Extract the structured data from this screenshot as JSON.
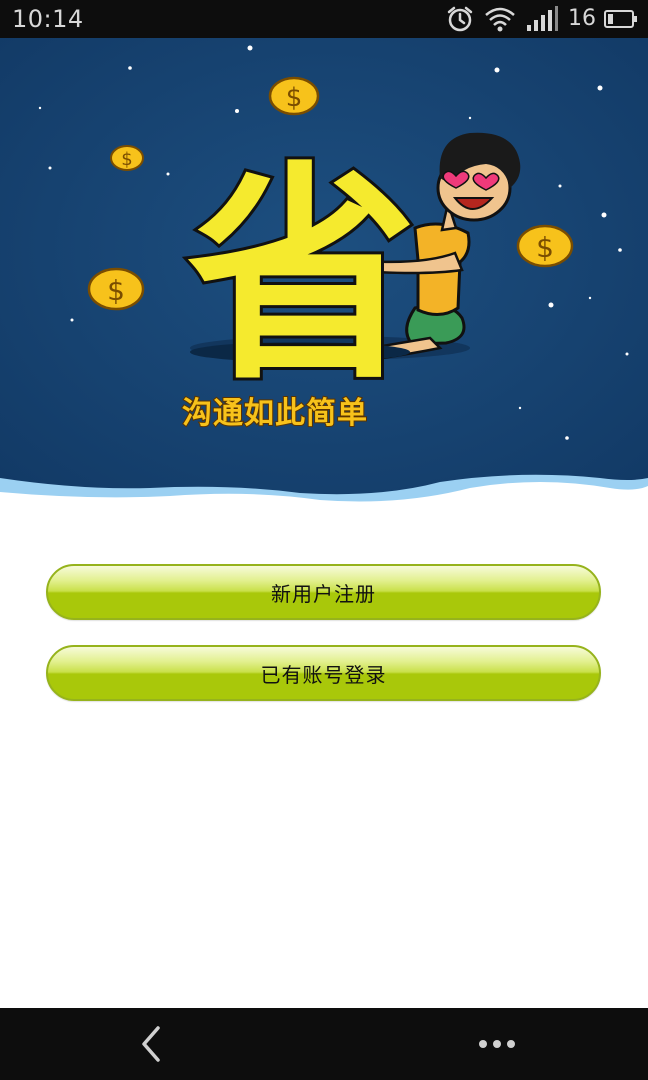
{
  "status_bar": {
    "time": "10:14",
    "battery_level": "16",
    "icons": [
      "alarm-icon",
      "wifi-icon",
      "signal-icon",
      "battery-icon"
    ]
  },
  "banner": {
    "slogan": "沟通如此简单",
    "logo_character": "省",
    "colors": {
      "sky": "#163f6b",
      "coin": "#f7c21b",
      "logo": "#f5ea2e",
      "wave": "#9bd0f2"
    }
  },
  "buttons": {
    "register_label": "新用户注册",
    "login_label": "已有账号登录",
    "accent": "#a9c80a"
  },
  "nav_bar": {
    "icons": [
      "back-icon",
      "more-icon"
    ]
  }
}
